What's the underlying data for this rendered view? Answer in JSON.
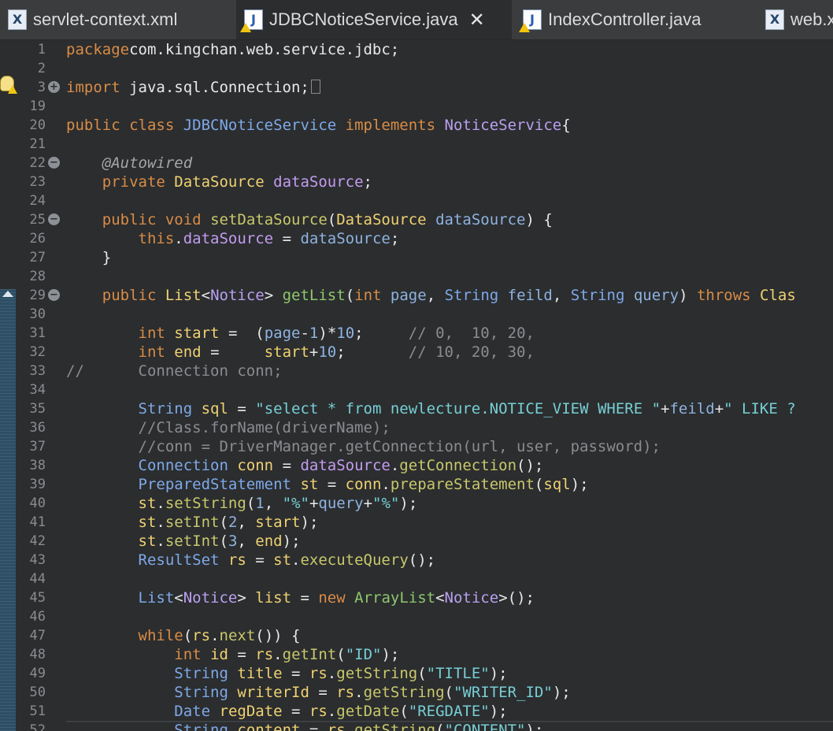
{
  "tabs": [
    {
      "label": "servlet-context.xml",
      "icon": "xml-file-icon",
      "active": false
    },
    {
      "label": "JDBCNoticeService.java",
      "icon": "java-file-warning-icon",
      "active": true
    },
    {
      "label": "IndexController.java",
      "icon": "java-file-warning-icon",
      "active": false
    },
    {
      "label": "web.x",
      "icon": "xml-file-icon",
      "active": false
    }
  ],
  "lines": [
    {
      "n": "1",
      "segs": [
        [
          "kw",
          "package"
        ],
        [
          "",
          "com.kingchan.web.service.jdbc;"
        ]
      ]
    },
    {
      "n": "2",
      "segs": []
    },
    {
      "n": "3",
      "segs": [
        [
          "kw",
          "import"
        ],
        [
          "",
          " java.sql.Connection;"
        ]
      ]
    },
    {
      "n": "19",
      "segs": []
    },
    {
      "n": "20",
      "segs": [
        [
          "kw",
          "public class"
        ],
        [
          "",
          " "
        ],
        [
          "ty",
          "JDBCNoticeService"
        ],
        [
          "",
          " "
        ],
        [
          "kw",
          "implements"
        ],
        [
          "",
          " "
        ],
        [
          "cls",
          "NoticeService"
        ],
        [
          "",
          "{"
        ]
      ]
    },
    {
      "n": "21",
      "segs": []
    },
    {
      "n": "22",
      "segs": [
        [
          "",
          "    "
        ],
        [
          "an",
          "@Autowired"
        ]
      ]
    },
    {
      "n": "23",
      "segs": [
        [
          "",
          "    "
        ],
        [
          "kw",
          "private"
        ],
        [
          "",
          " "
        ],
        [
          "vr",
          "DataSource"
        ],
        [
          "",
          " "
        ],
        [
          "fld",
          "dataSource"
        ],
        [
          "",
          ";"
        ]
      ]
    },
    {
      "n": "24",
      "segs": []
    },
    {
      "n": "25",
      "segs": [
        [
          "",
          "    "
        ],
        [
          "kw",
          "public void"
        ],
        [
          "",
          " "
        ],
        [
          "mt",
          "setDataSource"
        ],
        [
          "",
          "("
        ],
        [
          "vr",
          "DataSource"
        ],
        [
          "",
          " "
        ],
        [
          "pm",
          "dataSource"
        ],
        [
          "",
          ") {"
        ]
      ]
    },
    {
      "n": "26",
      "segs": [
        [
          "",
          "        "
        ],
        [
          "kw",
          "this"
        ],
        [
          "",
          "."
        ],
        [
          "fld",
          "dataSource"
        ],
        [
          "",
          " = "
        ],
        [
          "pm",
          "dataSource"
        ],
        [
          "",
          ";"
        ]
      ]
    },
    {
      "n": "27",
      "segs": [
        [
          "",
          "    }"
        ]
      ]
    },
    {
      "n": "28",
      "segs": []
    },
    {
      "n": "29",
      "segs": [
        [
          "",
          "    "
        ],
        [
          "kw",
          "public"
        ],
        [
          "",
          " "
        ],
        [
          "vr",
          "List"
        ],
        [
          "",
          "<"
        ],
        [
          "cls",
          "Notice"
        ],
        [
          "",
          "> "
        ],
        [
          "gn",
          "getList"
        ],
        [
          "",
          "("
        ],
        [
          "kw",
          "int"
        ],
        [
          "",
          " "
        ],
        [
          "pm",
          "page"
        ],
        [
          "",
          ", "
        ],
        [
          "ty",
          "String"
        ],
        [
          "",
          " "
        ],
        [
          "pm",
          "feild"
        ],
        [
          "",
          ", "
        ],
        [
          "ty",
          "String"
        ],
        [
          "",
          " "
        ],
        [
          "pm",
          "query"
        ],
        [
          "",
          ") "
        ],
        [
          "kw",
          "throws"
        ],
        [
          "",
          " "
        ],
        [
          "vr",
          "Clas"
        ]
      ]
    },
    {
      "n": "30",
      "segs": []
    },
    {
      "n": "31",
      "segs": [
        [
          "",
          "        "
        ],
        [
          "kw",
          "int"
        ],
        [
          "",
          " "
        ],
        [
          "vr",
          "start"
        ],
        [
          "",
          " =  ("
        ],
        [
          "pm",
          "page"
        ],
        [
          "",
          "-"
        ],
        [
          "nm",
          "1"
        ],
        [
          "",
          ")*"
        ],
        [
          "nm",
          "10"
        ],
        [
          "",
          ";     "
        ],
        [
          "cm",
          "// 0,  10, 20,"
        ]
      ]
    },
    {
      "n": "32",
      "segs": [
        [
          "",
          "        "
        ],
        [
          "kw",
          "int"
        ],
        [
          "",
          " "
        ],
        [
          "vr",
          "end"
        ],
        [
          "",
          " =     "
        ],
        [
          "vr",
          "start"
        ],
        [
          "",
          "+"
        ],
        [
          "nm",
          "10"
        ],
        [
          "",
          ";       "
        ],
        [
          "cm",
          "// 10, 20, 30,"
        ]
      ]
    },
    {
      "n": "33",
      "segs": [
        [
          "cm",
          "//      Connection conn;"
        ]
      ]
    },
    {
      "n": "34",
      "segs": []
    },
    {
      "n": "35",
      "segs": [
        [
          "",
          "        "
        ],
        [
          "ty",
          "String"
        ],
        [
          "",
          " "
        ],
        [
          "vr",
          "sql"
        ],
        [
          "",
          " = "
        ],
        [
          "str",
          "\"select * from newlecture.NOTICE_VIEW WHERE \""
        ],
        [
          "",
          "+"
        ],
        [
          "pm",
          "feild"
        ],
        [
          "",
          "+"
        ],
        [
          "str",
          "\" LIKE ?"
        ]
      ]
    },
    {
      "n": "36",
      "segs": [
        [
          "",
          "        "
        ],
        [
          "cm",
          "//Class.forName(driverName);"
        ]
      ]
    },
    {
      "n": "37",
      "segs": [
        [
          "",
          "        "
        ],
        [
          "cm",
          "//conn = DriverManager.getConnection(url, user, password);"
        ]
      ]
    },
    {
      "n": "38",
      "segs": [
        [
          "",
          "        "
        ],
        [
          "ty",
          "Connection"
        ],
        [
          "",
          " "
        ],
        [
          "vr",
          "conn"
        ],
        [
          "",
          " = "
        ],
        [
          "fld",
          "dataSource"
        ],
        [
          "",
          "."
        ],
        [
          "mt",
          "getConnection"
        ],
        [
          "",
          "();"
        ]
      ]
    },
    {
      "n": "39",
      "segs": [
        [
          "",
          "        "
        ],
        [
          "ty",
          "PreparedStatement"
        ],
        [
          "",
          " "
        ],
        [
          "vr",
          "st"
        ],
        [
          "",
          " = "
        ],
        [
          "vr",
          "conn"
        ],
        [
          "",
          "."
        ],
        [
          "mt",
          "prepareStatement"
        ],
        [
          "",
          "("
        ],
        [
          "vr",
          "sql"
        ],
        [
          "",
          "); "
        ]
      ]
    },
    {
      "n": "40",
      "segs": [
        [
          "",
          "        "
        ],
        [
          "vr",
          "st"
        ],
        [
          "",
          "."
        ],
        [
          "mt",
          "setString"
        ],
        [
          "",
          "("
        ],
        [
          "nm",
          "1"
        ],
        [
          "",
          ", "
        ],
        [
          "str",
          "\"%\""
        ],
        [
          "",
          "+"
        ],
        [
          "pm",
          "query"
        ],
        [
          "",
          "+"
        ],
        [
          "str",
          "\"%\""
        ],
        [
          "",
          "); "
        ]
      ]
    },
    {
      "n": "41",
      "segs": [
        [
          "",
          "        "
        ],
        [
          "vr",
          "st"
        ],
        [
          "",
          "."
        ],
        [
          "mt",
          "setInt"
        ],
        [
          "",
          "("
        ],
        [
          "nm",
          "2"
        ],
        [
          "",
          ", "
        ],
        [
          "vr",
          "start"
        ],
        [
          "",
          "); "
        ]
      ]
    },
    {
      "n": "42",
      "segs": [
        [
          "",
          "        "
        ],
        [
          "vr",
          "st"
        ],
        [
          "",
          "."
        ],
        [
          "mt",
          "setInt"
        ],
        [
          "",
          "("
        ],
        [
          "nm",
          "3"
        ],
        [
          "",
          ", "
        ],
        [
          "vr",
          "end"
        ],
        [
          "",
          "); "
        ]
      ]
    },
    {
      "n": "43",
      "segs": [
        [
          "",
          "        "
        ],
        [
          "ty",
          "ResultSet"
        ],
        [
          "",
          " "
        ],
        [
          "vr",
          "rs"
        ],
        [
          "",
          " = "
        ],
        [
          "vr",
          "st"
        ],
        [
          "",
          "."
        ],
        [
          "mt",
          "executeQuery"
        ],
        [
          "",
          "();"
        ]
      ]
    },
    {
      "n": "44",
      "segs": []
    },
    {
      "n": "45",
      "segs": [
        [
          "",
          "        "
        ],
        [
          "ty",
          "List"
        ],
        [
          "",
          "<"
        ],
        [
          "cls",
          "Notice"
        ],
        [
          "",
          "> "
        ],
        [
          "vr",
          "list"
        ],
        [
          "",
          " = "
        ],
        [
          "kw",
          "new"
        ],
        [
          "",
          " "
        ],
        [
          "gn",
          "ArrayList"
        ],
        [
          "",
          "<"
        ],
        [
          "cls",
          "Notice"
        ],
        [
          "",
          ">();"
        ]
      ]
    },
    {
      "n": "46",
      "segs": []
    },
    {
      "n": "47",
      "segs": [
        [
          "",
          "        "
        ],
        [
          "kw",
          "while"
        ],
        [
          "",
          "("
        ],
        [
          "vr",
          "rs"
        ],
        [
          "",
          "."
        ],
        [
          "mt",
          "next"
        ],
        [
          "",
          "()) {"
        ]
      ]
    },
    {
      "n": "48",
      "segs": [
        [
          "",
          "            "
        ],
        [
          "kw",
          "int"
        ],
        [
          "",
          " "
        ],
        [
          "vr",
          "id"
        ],
        [
          "",
          " = "
        ],
        [
          "vr",
          "rs"
        ],
        [
          "",
          "."
        ],
        [
          "mt",
          "getInt"
        ],
        [
          "",
          "("
        ],
        [
          "str",
          "\"ID\""
        ],
        [
          "",
          "); "
        ]
      ]
    },
    {
      "n": "49",
      "segs": [
        [
          "",
          "            "
        ],
        [
          "ty",
          "String"
        ],
        [
          "",
          " "
        ],
        [
          "vr",
          "title"
        ],
        [
          "",
          " = "
        ],
        [
          "vr",
          "rs"
        ],
        [
          "",
          "."
        ],
        [
          "mt",
          "getString"
        ],
        [
          "",
          "("
        ],
        [
          "str",
          "\"TITLE\""
        ],
        [
          "",
          "); "
        ]
      ]
    },
    {
      "n": "50",
      "segs": [
        [
          "",
          "            "
        ],
        [
          "ty",
          "String"
        ],
        [
          "",
          " "
        ],
        [
          "vr",
          "writerId"
        ],
        [
          "",
          " = "
        ],
        [
          "vr",
          "rs"
        ],
        [
          "",
          "."
        ],
        [
          "mt",
          "getString"
        ],
        [
          "",
          "("
        ],
        [
          "str",
          "\"WRITER_ID\""
        ],
        [
          "",
          "); "
        ]
      ]
    },
    {
      "n": "51",
      "segs": [
        [
          "",
          "            "
        ],
        [
          "ty",
          "Date"
        ],
        [
          "",
          " "
        ],
        [
          "vr",
          "regDate"
        ],
        [
          "",
          " = "
        ],
        [
          "vr",
          "rs"
        ],
        [
          "",
          "."
        ],
        [
          "mt",
          "getDate"
        ],
        [
          "",
          "("
        ],
        [
          "str",
          "\"REGDATE\""
        ],
        [
          "",
          "); "
        ]
      ]
    },
    {
      "n": "52",
      "segs": [
        [
          "",
          "            "
        ],
        [
          "ty",
          "String"
        ],
        [
          "",
          " "
        ],
        [
          "vr",
          "content"
        ],
        [
          "",
          " = "
        ],
        [
          "vr",
          "rs"
        ],
        [
          "",
          "."
        ],
        [
          "mt",
          "getString"
        ],
        [
          "",
          "("
        ],
        [
          "str",
          "\"CONTENT\""
        ],
        [
          "",
          "); "
        ]
      ]
    }
  ],
  "folds": {
    "3": "plus",
    "22": "minus",
    "25": "minus",
    "29": "minus"
  }
}
